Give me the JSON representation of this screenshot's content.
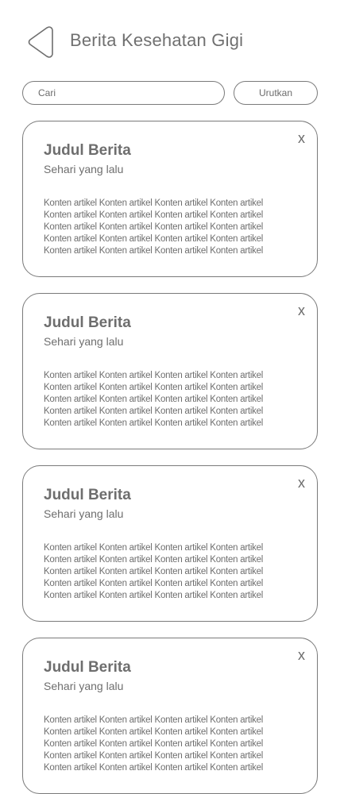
{
  "header": {
    "back_icon": "chevron-left-icon",
    "title": "Berita Kesehatan Gigi"
  },
  "toolbar": {
    "search_placeholder": "Cari",
    "sort_label": "Urutkan"
  },
  "cards": [
    {
      "close_label": "x",
      "title": "Judul Berita",
      "time": "Sehari yang lalu",
      "content_lines": [
        "Konten artikel Konten artikel Konten artikel Konten artikel",
        "Konten artikel Konten artikel Konten artikel Konten artikel",
        "Konten artikel Konten artikel Konten artikel Konten artikel",
        "Konten artikel Konten artikel Konten artikel Konten artikel",
        "Konten artikel Konten artikel Konten artikel Konten artikel"
      ]
    },
    {
      "close_label": "x",
      "title": "Judul Berita",
      "time": "Sehari yang lalu",
      "content_lines": [
        "Konten artikel Konten artikel Konten artikel Konten artikel",
        "Konten artikel Konten artikel Konten artikel Konten artikel",
        "Konten artikel Konten artikel Konten artikel Konten artikel",
        "Konten artikel Konten artikel Konten artikel Konten artikel",
        "Konten artikel Konten artikel Konten artikel Konten artikel"
      ]
    },
    {
      "close_label": "x",
      "title": "Judul Berita",
      "time": "Sehari yang lalu",
      "content_lines": [
        "Konten artikel Konten artikel Konten artikel Konten artikel",
        "Konten artikel Konten artikel Konten artikel Konten artikel",
        "Konten artikel Konten artikel Konten artikel Konten artikel",
        "Konten artikel Konten artikel Konten artikel Konten artikel",
        "Konten artikel Konten artikel Konten artikel Konten artikel"
      ]
    },
    {
      "close_label": "x",
      "title": "Judul Berita",
      "time": "Sehari yang lalu",
      "content_lines": [
        "Konten artikel Konten artikel Konten artikel Konten artikel",
        "Konten artikel Konten artikel Konten artikel Konten artikel",
        "Konten artikel Konten artikel Konten artikel Konten artikel",
        "Konten artikel Konten artikel Konten artikel Konten artikel",
        "Konten artikel Konten artikel Konten artikel Konten artikel"
      ]
    }
  ]
}
